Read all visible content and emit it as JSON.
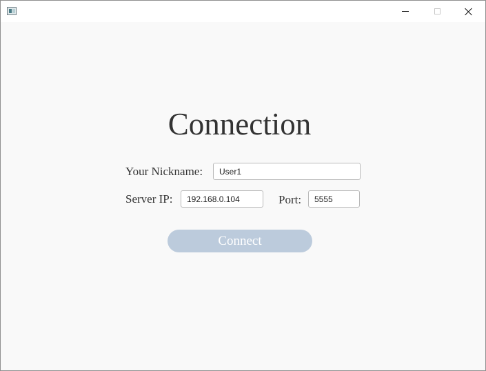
{
  "window": {
    "icon": "app-window-icon",
    "controls": [
      "minimize-icon",
      "maximize-icon",
      "close-icon"
    ]
  },
  "heading": "Connection",
  "form": {
    "nickname_label": "Your Nickname:",
    "nickname_value": "User1",
    "server_ip_label": "Server IP:",
    "server_ip_value": "192.168.0.104",
    "port_label": "Port:",
    "port_value": "5555"
  },
  "connect_button": "Connect",
  "colors": {
    "connect_button_bg": "#bccbdc",
    "background": "#f9f9f9"
  }
}
